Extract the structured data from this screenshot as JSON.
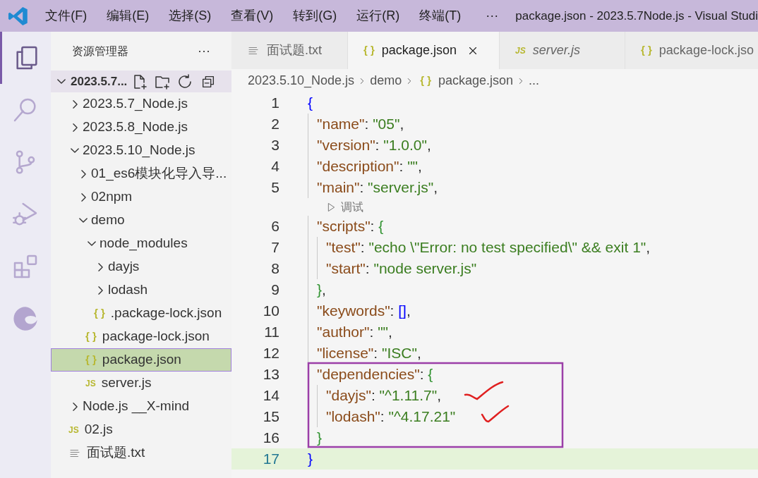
{
  "title_bar": {
    "menus": [
      "文件(F)",
      "编辑(E)",
      "选择(S)",
      "查看(V)",
      "转到(G)",
      "运行(R)",
      "终端(T)"
    ],
    "more": "···",
    "title": "package.json - 2023.5.7Node.js - Visual Studi"
  },
  "activity_bar": [
    {
      "kind": "explorer",
      "selected": true
    },
    {
      "kind": "search",
      "selected": false
    },
    {
      "kind": "source-control",
      "selected": false
    },
    {
      "kind": "run-debug",
      "selected": false
    },
    {
      "kind": "extensions",
      "selected": false
    },
    {
      "kind": "edge",
      "selected": false
    }
  ],
  "sidebar": {
    "title": "资源管理器",
    "more": "···",
    "root": {
      "label": "2023.5.7...",
      "expanded": true
    },
    "items": [
      {
        "label": "2023.5.7_Node.js",
        "kind": "folder",
        "expanded": false,
        "selected": false
      },
      {
        "label": "2023.5.8_Node.js",
        "kind": "folder",
        "expanded": false,
        "selected": false
      },
      {
        "label": "2023.5.10_Node.js",
        "kind": "folder",
        "expanded": true,
        "selected": false,
        "children": [
          {
            "label": "01_es6模块化导入导...",
            "kind": "folder",
            "expanded": false,
            "selected": false
          },
          {
            "label": "02npm",
            "kind": "folder",
            "expanded": false,
            "selected": false
          },
          {
            "label": "demo",
            "kind": "folder",
            "expanded": true,
            "selected": false,
            "children": [
              {
                "label": "node_modules",
                "kind": "folder",
                "expanded": true,
                "selected": false,
                "children": [
                  {
                    "label": "dayjs",
                    "kind": "folder",
                    "expanded": false,
                    "selected": false
                  },
                  {
                    "label": "lodash",
                    "kind": "folder",
                    "expanded": false,
                    "selected": false
                  },
                  {
                    "label": ".package-lock.json",
                    "kind": "json",
                    "icon": "{ }",
                    "selected": false
                  }
                ]
              },
              {
                "label": "package-lock.json",
                "kind": "json",
                "icon": "{ }",
                "selected": false
              },
              {
                "label": "package.json",
                "kind": "json",
                "icon": "{ }",
                "selected": true
              },
              {
                "label": "server.js",
                "kind": "js",
                "icon": "JS",
                "selected": false
              }
            ]
          }
        ]
      },
      {
        "label": "Node.js __X-mind",
        "kind": "folder",
        "expanded": false,
        "selected": false
      },
      {
        "label": "02.js",
        "kind": "js",
        "icon": "JS",
        "selected": false
      },
      {
        "label": "面试题.txt",
        "kind": "txt",
        "selected": false
      }
    ]
  },
  "tabs": [
    {
      "label": "面试题.txt",
      "kind": "txt",
      "selected": false,
      "preview": false
    },
    {
      "label": "package.json",
      "kind": "json",
      "icon": "{ }",
      "selected": true,
      "preview": false
    },
    {
      "label": "server.js",
      "kind": "js",
      "icon": "JS",
      "selected": false,
      "preview": true
    },
    {
      "label": "package-lock.jso",
      "kind": "json",
      "icon": "{ }",
      "selected": false,
      "preview": false
    }
  ],
  "breadcrumbs": [
    {
      "label": "2023.5.10_Node.js",
      "kind": "folder"
    },
    {
      "label": "demo",
      "kind": "folder"
    },
    {
      "label": "package.json",
      "kind": "json",
      "icon": "{ }"
    },
    {
      "label": "...",
      "kind": "more"
    }
  ],
  "code_lines": [
    {
      "kind": "code",
      "number": "1",
      "current": false,
      "tokens": [
        {
          "kind": "bracket",
          "text": "{",
          "color": "#0000ff"
        }
      ]
    },
    {
      "kind": "code",
      "number": "2",
      "current": false,
      "tokens": [
        {
          "kind": "key",
          "text": "\"name\""
        },
        {
          "kind": "punct",
          "text": ": "
        },
        {
          "kind": "string",
          "text": "\"05\""
        },
        {
          "kind": "punct",
          "text": ","
        }
      ]
    },
    {
      "kind": "code",
      "number": "3",
      "current": false,
      "tokens": [
        {
          "kind": "key",
          "text": "\"version\""
        },
        {
          "kind": "punct",
          "text": ": "
        },
        {
          "kind": "string",
          "text": "\"1.0.0\""
        },
        {
          "kind": "punct",
          "text": ","
        }
      ]
    },
    {
      "kind": "code",
      "number": "4",
      "current": false,
      "tokens": [
        {
          "kind": "key",
          "text": "\"description\""
        },
        {
          "kind": "punct",
          "text": ": "
        },
        {
          "kind": "string",
          "text": "\"\""
        },
        {
          "kind": "punct",
          "text": ","
        }
      ]
    },
    {
      "kind": "code",
      "number": "5",
      "current": false,
      "tokens": [
        {
          "kind": "key",
          "text": "\"main\""
        },
        {
          "kind": "punct",
          "text": ": "
        },
        {
          "kind": "string",
          "text": "\"server.js\""
        },
        {
          "kind": "punct",
          "text": ","
        }
      ]
    },
    {
      "kind": "codelens",
      "label": "调试"
    },
    {
      "kind": "code",
      "number": "6",
      "current": false,
      "tokens": [
        {
          "kind": "key",
          "text": "\"scripts\""
        },
        {
          "kind": "punct",
          "text": ": "
        },
        {
          "kind": "bracket",
          "text": "{",
          "color": "#319331"
        }
      ]
    },
    {
      "kind": "code",
      "number": "7",
      "current": false,
      "tokens": [
        {
          "kind": "key",
          "text": "\"test\""
        },
        {
          "kind": "punct",
          "text": ": "
        },
        {
          "kind": "string",
          "text": "\"echo \\\"Error: no test specified\\\" && exit 1\""
        },
        {
          "kind": "punct",
          "text": ","
        }
      ]
    },
    {
      "kind": "code",
      "number": "8",
      "current": false,
      "tokens": [
        {
          "kind": "key",
          "text": "\"start\""
        },
        {
          "kind": "punct",
          "text": ": "
        },
        {
          "kind": "string",
          "text": "\"node server.js\""
        }
      ]
    },
    {
      "kind": "code",
      "number": "9",
      "current": false,
      "tokens": [
        {
          "kind": "bracket",
          "text": "}",
          "color": "#319331"
        },
        {
          "kind": "punct",
          "text": ","
        }
      ]
    },
    {
      "kind": "code",
      "number": "10",
      "current": false,
      "tokens": [
        {
          "kind": "key",
          "text": "\"keywords\""
        },
        {
          "kind": "punct",
          "text": ": "
        },
        {
          "kind": "bracket",
          "text": "[]",
          "color": "#0000ff"
        },
        {
          "kind": "punct",
          "text": ","
        }
      ]
    },
    {
      "kind": "code",
      "number": "11",
      "current": false,
      "tokens": [
        {
          "kind": "key",
          "text": "\"author\""
        },
        {
          "kind": "punct",
          "text": ": "
        },
        {
          "kind": "string",
          "text": "\"\""
        },
        {
          "kind": "punct",
          "text": ","
        }
      ]
    },
    {
      "kind": "code",
      "number": "12",
      "current": false,
      "tokens": [
        {
          "kind": "key",
          "text": "\"license\""
        },
        {
          "kind": "punct",
          "text": ": "
        },
        {
          "kind": "string",
          "text": "\"ISC\""
        },
        {
          "kind": "punct",
          "text": ","
        }
      ]
    },
    {
      "kind": "code",
      "number": "13",
      "current": false,
      "tokens": [
        {
          "kind": "key",
          "text": "\"dependencies\""
        },
        {
          "kind": "punct",
          "text": ": "
        },
        {
          "kind": "bracket",
          "text": "{",
          "color": "#319331"
        }
      ]
    },
    {
      "kind": "code",
      "number": "14",
      "current": false,
      "tokens": [
        {
          "kind": "key",
          "text": "\"dayjs\""
        },
        {
          "kind": "punct",
          "text": ": "
        },
        {
          "kind": "string",
          "text": "\"^1.11.7\""
        },
        {
          "kind": "punct",
          "text": ","
        }
      ]
    },
    {
      "kind": "code",
      "number": "15",
      "current": false,
      "tokens": [
        {
          "kind": "key",
          "text": "\"lodash\""
        },
        {
          "kind": "punct",
          "text": ": "
        },
        {
          "kind": "string",
          "text": "\"^4.17.21\""
        }
      ]
    },
    {
      "kind": "code",
      "number": "16",
      "current": false,
      "tokens": [
        {
          "kind": "bracket",
          "text": "}",
          "color": "#319331"
        }
      ]
    },
    {
      "kind": "code",
      "number": "17",
      "current": true,
      "tokens": [
        {
          "kind": "bracket",
          "text": "}",
          "color": "#0000ff"
        }
      ]
    }
  ]
}
